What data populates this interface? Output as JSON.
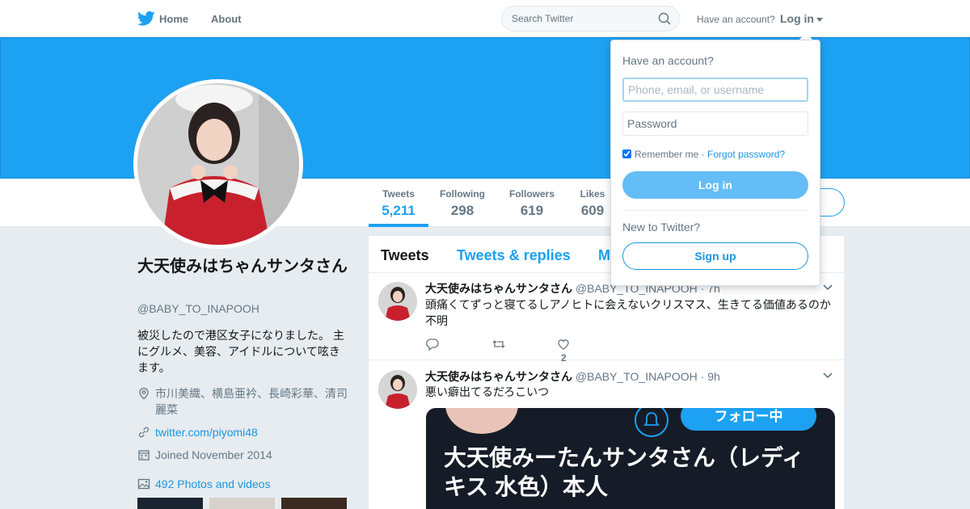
{
  "nav": {
    "home_label": "Home",
    "about_label": "About",
    "search_placeholder": "Search Twitter",
    "have_account": "Have an account?",
    "login_label": "Log in"
  },
  "profile": {
    "name": "大天使みはちゃんサンタさん",
    "handle": "@BABY_TO_INAPOOH",
    "bio": "被災したので港区女子になりました。 主にグルメ、美容、アイドルについて呟きます。",
    "location": "市川美織、横島亜衿、長崎彩華、清司麗菜",
    "url": "twitter.com/piyomi48",
    "joined": "Joined November 2014",
    "photos": "492 Photos and videos"
  },
  "stats": [
    {
      "label": "Tweets",
      "value": "5,211"
    },
    {
      "label": "Following",
      "value": "298"
    },
    {
      "label": "Followers",
      "value": "619"
    },
    {
      "label": "Likes",
      "value": "609"
    }
  ],
  "timeline": {
    "tabs": [
      "Tweets",
      "Tweets & replies",
      "M"
    ],
    "tweets": [
      {
        "name": "大天使みはちゃんサンタさん",
        "handle": "@BABY_TO_INAPOOH",
        "time": "· 7h",
        "text": "頭痛くてずっと寝てるしアノヒトに会えないクリスマス、生きてる価値あるのか不明",
        "likes": "2"
      },
      {
        "name": "大天使みはちゃんサンタさん",
        "handle": "@BABY_TO_INAPOOH",
        "time": "· 9h",
        "text": "悪い癖出てるだろこいつ",
        "media_pill": "フォロー中",
        "media_text": "大天使みーたんサンタさん（レディキス 水色）本人"
      }
    ]
  },
  "login_dropdown": {
    "title": "Have an account?",
    "username_placeholder": "Phone, email, or username",
    "password_placeholder": "Password",
    "remember_label": "Remember me",
    "separator": "·",
    "forgot_label": "Forgot password?",
    "login_button": "Log in",
    "new_label": "New to Twitter?",
    "signup_button": "Sign up"
  },
  "colors": {
    "brand": "#1da1f2",
    "link": "#1b95e0",
    "muted": "#657786"
  },
  "icons": [
    "twitter-bird-icon",
    "search-icon",
    "location-icon",
    "link-icon",
    "calendar-icon",
    "photo-icon",
    "reply-icon",
    "retweet-icon",
    "like-icon",
    "chevron-down-icon",
    "bell-icon"
  ]
}
